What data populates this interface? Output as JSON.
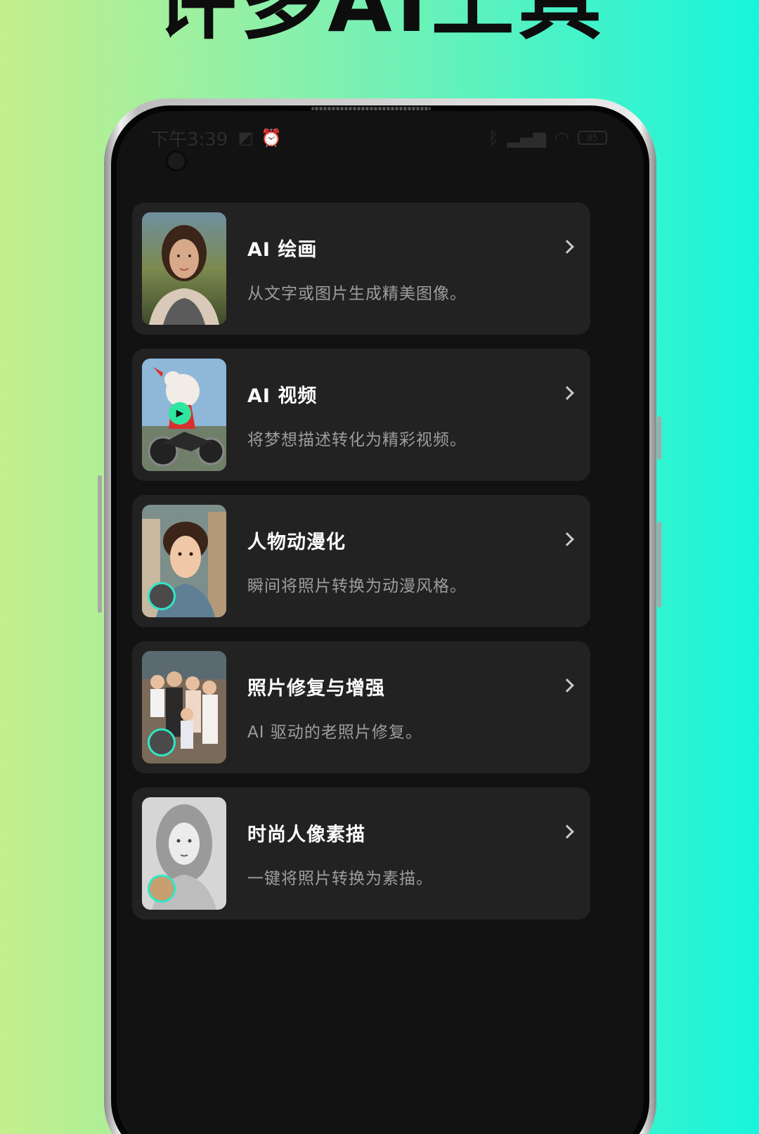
{
  "promo": {
    "title": "许多AI工具"
  },
  "status_bar": {
    "time": "下午3:39",
    "battery": "85"
  },
  "features": [
    {
      "title": "AI 绘画",
      "description": "从文字或图片生成精美图像。",
      "thumbnail": "woman-portrait"
    },
    {
      "title": "AI 视频",
      "description": "将梦想描述转化为精彩视频。",
      "thumbnail": "dog-on-motorcycle"
    },
    {
      "title": "人物动漫化",
      "description": "瞬间将照片转换为动漫风格。",
      "thumbnail": "anime-man"
    },
    {
      "title": "照片修复与增强",
      "description": "AI 驱动的老照片修复。",
      "thumbnail": "family-photo"
    },
    {
      "title": "时尚人像素描",
      "description": "一键将照片转换为素描。",
      "thumbnail": "sketch-portrait"
    }
  ],
  "colors": {
    "background_gradient_start": "#c4ef8c",
    "background_gradient_end": "#17f5dc",
    "screen_background": "#121212",
    "card_background": "#222222",
    "accent": "#2fe6c5"
  }
}
